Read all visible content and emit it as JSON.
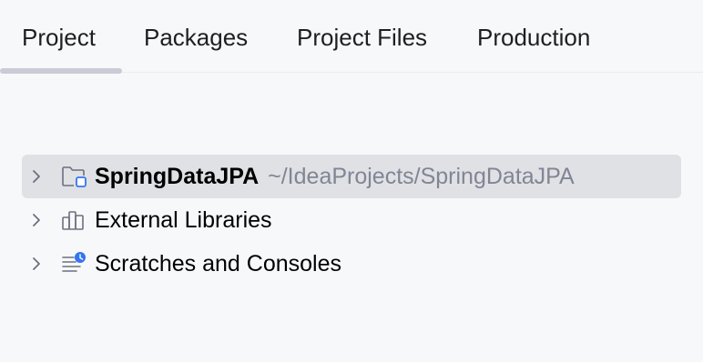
{
  "tabs": [
    {
      "label": "Project",
      "active": true
    },
    {
      "label": "Packages",
      "active": false
    },
    {
      "label": "Project Files",
      "active": false
    },
    {
      "label": "Production",
      "active": false
    }
  ],
  "tree": {
    "items": [
      {
        "label": "SpringDataJPA",
        "path": "~/IdeaProjects/SpringDataJPA",
        "icon": "project-folder-icon",
        "selected": true,
        "collapsed": true
      },
      {
        "label": "External Libraries",
        "icon": "libraries-icon",
        "selected": false,
        "collapsed": true
      },
      {
        "label": "Scratches and Consoles",
        "icon": "scratches-icon",
        "selected": false,
        "collapsed": true
      }
    ]
  },
  "colors": {
    "background": "#f7f8fa",
    "selection": "#dfe1e5",
    "accent": "#3574f0",
    "path_text": "#818594",
    "tab_underline": "#c9ccd6"
  }
}
